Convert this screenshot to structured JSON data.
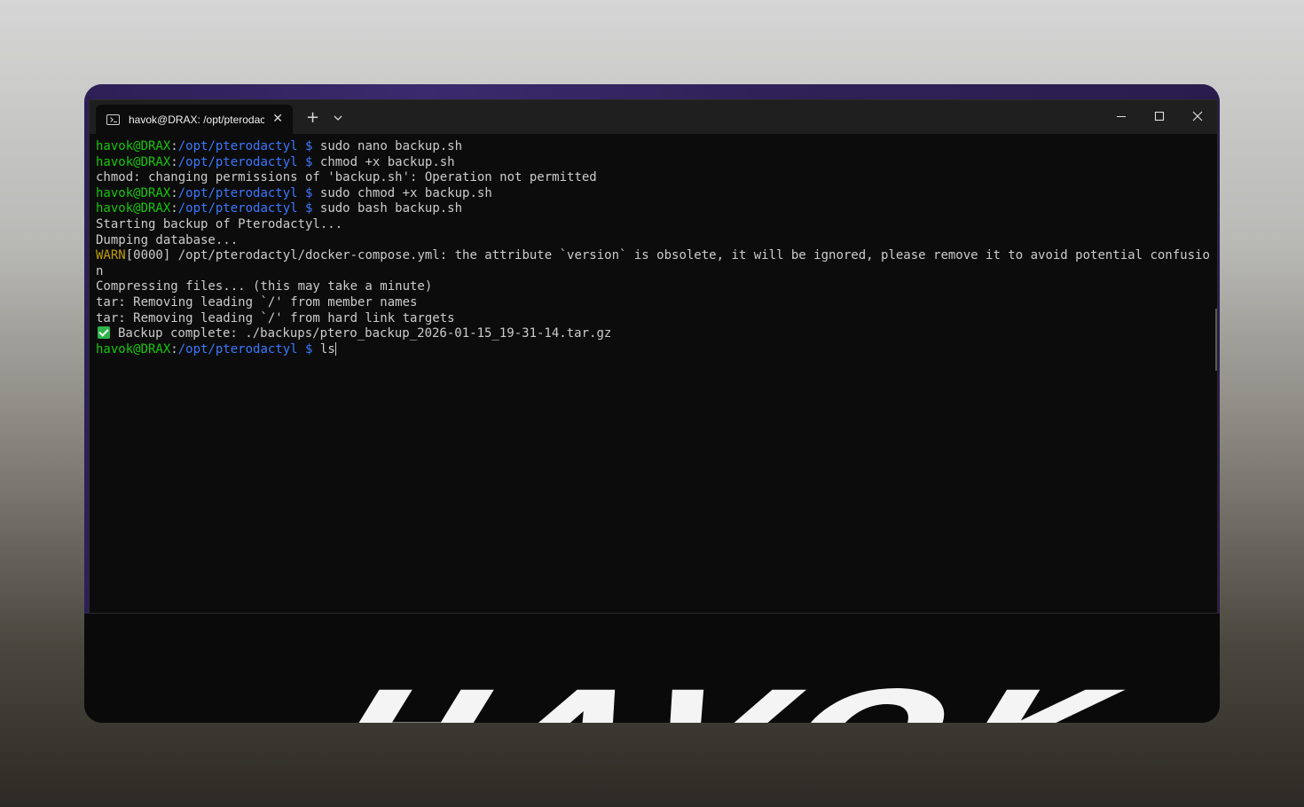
{
  "window": {
    "tab_title": "havok@DRAX: /opt/pterodactyl",
    "tab_close_glyph": "✕",
    "new_tab_glyph": "+",
    "icons": [
      "terminal-icon",
      "close-icon",
      "plus-icon",
      "chevron-down-icon",
      "minimize-icon",
      "maximize-icon",
      "close-window-icon"
    ]
  },
  "prompt": {
    "user_host": "havok@DRAX",
    "separator": ":",
    "path": "/opt/pterodactyl",
    "symbol": " $ "
  },
  "lines": [
    {
      "kind": "cmd",
      "cmd": "sudo nano backup.sh"
    },
    {
      "kind": "cmd",
      "cmd": "chmod +x backup.sh"
    },
    {
      "kind": "out",
      "text": "chmod: changing permissions of 'backup.sh': Operation not permitted"
    },
    {
      "kind": "cmd",
      "cmd": "sudo chmod +x backup.sh"
    },
    {
      "kind": "cmd",
      "cmd": "sudo bash backup.sh"
    },
    {
      "kind": "out",
      "text": "Starting backup of Pterodactyl..."
    },
    {
      "kind": "out",
      "text": "Dumping database..."
    },
    {
      "kind": "warn",
      "tag": "WARN",
      "text": "[0000] /opt/pterodactyl/docker-compose.yml: the attribute `version` is obsolete, it will be ignored, please remove it to avoid potential confusio"
    },
    {
      "kind": "out",
      "text": "n"
    },
    {
      "kind": "out",
      "text": "Compressing files... (this may take a minute)"
    },
    {
      "kind": "out",
      "text": "tar: Removing leading `/' from member names"
    },
    {
      "kind": "out",
      "text": "tar: Removing leading `/' from hard link targets"
    },
    {
      "kind": "check",
      "text": "Backup complete: ./backups/ptero_backup_2026-01-15_19-31-14.tar.gz"
    },
    {
      "kind": "input",
      "cmd": "ls"
    }
  ],
  "wallpaper_text": "HAVOK",
  "colors": {
    "user": "#16c60c",
    "path": "#3b78ff",
    "warn": "#c19c00",
    "text": "#cccccc",
    "background": "#0c0c0c"
  }
}
